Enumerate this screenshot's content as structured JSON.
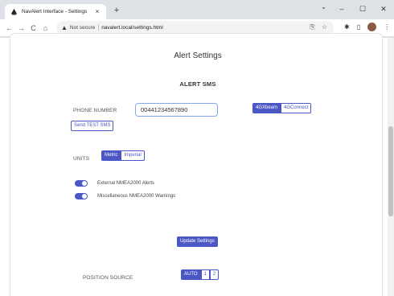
{
  "browser": {
    "tab_title": "NavAlert Interface - Settings",
    "tab_close": "×",
    "new_tab": "+",
    "tab_menu": "⌄",
    "window_minimize": "–",
    "window_maximize": "☐",
    "window_close": "✕",
    "back": "←",
    "forward": "→",
    "reload": "C",
    "home": "⌂",
    "security_label": "Not secure",
    "url": "navalert.local/settings.html",
    "share_icon": "⎘",
    "star_icon": "☆",
    "extensions_icon": "✱",
    "sidepanel_icon": "▯",
    "menu_icon": "⋮"
  },
  "page": {
    "title": "Alert Settings",
    "section_title": "ALERT SMS",
    "phone_label": "PHONE NUMBER",
    "phone_value": "00441234567890",
    "network_options": [
      "4GXbeam",
      "4GConnect"
    ],
    "network_selected": "4GXbeam",
    "send_test_label": "Send TEST SMS",
    "units_label": "UNITS",
    "units_options": [
      "Metric",
      "Imperial"
    ],
    "units_selected": "Metric",
    "toggles": [
      {
        "label": "External NMEA2000 Alerts",
        "on": true
      },
      {
        "label": "Miscellaneous NMEA2000 Warnings",
        "on": true
      }
    ],
    "update_label": "Update Settings",
    "position_label": "POSITION SOURCE",
    "position_options": [
      "AUTO",
      "1",
      "2"
    ],
    "position_selected": "AUTO"
  },
  "colors": {
    "accent": "#4a57c4",
    "input_border": "#86a7e6"
  }
}
